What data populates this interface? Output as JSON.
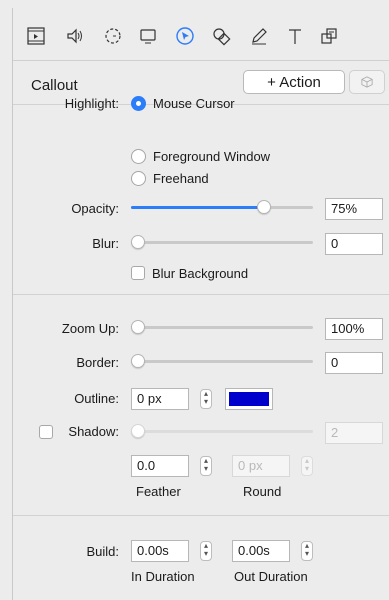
{
  "toolbar": {
    "icons": [
      "film-icon",
      "audio-icon",
      "timer-icon",
      "screen-icon",
      "cursor-icon",
      "shapes-icon",
      "pen-icon",
      "text-icon",
      "layers-icon"
    ]
  },
  "header": {
    "title": "Callout",
    "action_label": "+ Action"
  },
  "highlight": {
    "label": "Highlight:",
    "options": [
      "Mouse Cursor",
      "Foreground Window",
      "Freehand"
    ],
    "selected": "Mouse Cursor"
  },
  "opacity": {
    "label": "Opacity:",
    "value": "75%",
    "level": 0.75
  },
  "blur": {
    "label": "Blur:",
    "value": "0",
    "level": 0,
    "checkbox_label": "Blur Background"
  },
  "zoom": {
    "label": "Zoom Up:",
    "value": "100%",
    "level": 0
  },
  "border": {
    "label": "Border:",
    "value": "0",
    "level": 0
  },
  "outline": {
    "label": "Outline:",
    "value": "0 px",
    "color": "#0000cc"
  },
  "shadow": {
    "label": "Shadow:",
    "value": "2",
    "level": 0,
    "feather_value": "0.0",
    "feather_label": "Feather",
    "round_value": "0 px",
    "round_label": "Round"
  },
  "build": {
    "label": "Build:",
    "in_value": "0.00s",
    "in_label": "In Duration",
    "out_value": "0.00s",
    "out_label": "Out Duration"
  },
  "colors": {
    "accent": "#2c7dfa"
  }
}
